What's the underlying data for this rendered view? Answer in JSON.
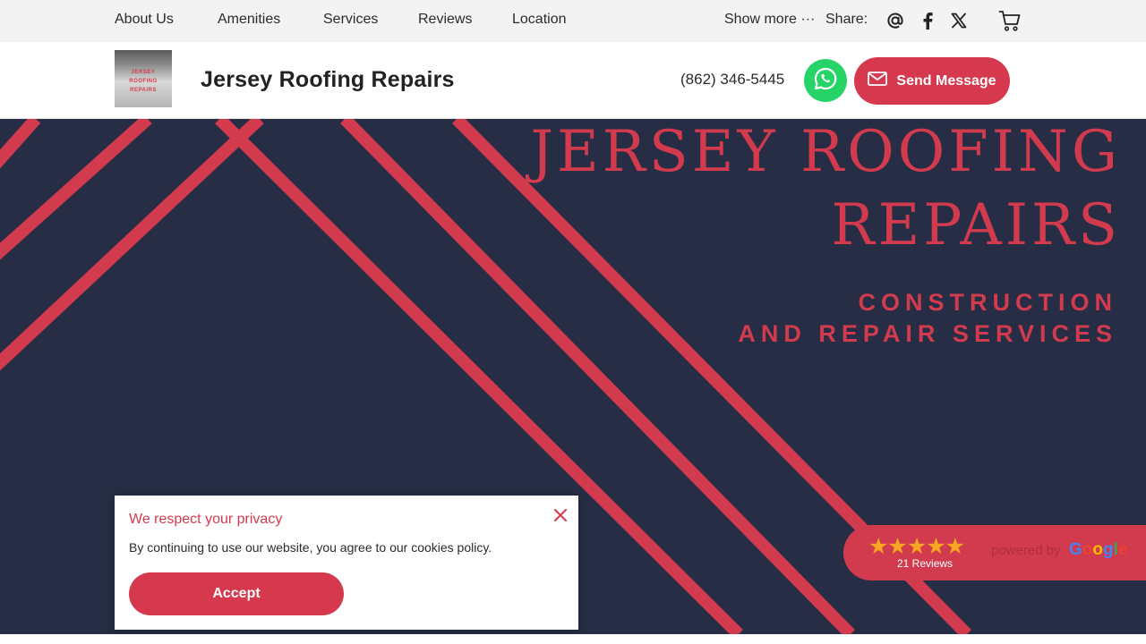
{
  "nav": {
    "items": [
      {
        "label": "About Us"
      },
      {
        "label": "Amenities"
      },
      {
        "label": "Services"
      },
      {
        "label": "Reviews"
      },
      {
        "label": "Location"
      }
    ],
    "show_more": "Show more ···",
    "share_label": "Share:",
    "share_icons": [
      "at-icon",
      "facebook-icon",
      "x-icon"
    ],
    "cart_icon": "cart-icon"
  },
  "header": {
    "logo_text": "JERSEY ROOFING REPAIRS",
    "brand_name": "Jersey Roofing Repairs",
    "phone": "(862) 346-5445",
    "whatsapp_icon": "whatsapp-icon",
    "send_button_label": "Send Message",
    "send_icon": "mail-icon"
  },
  "hero": {
    "title_line1": "JERSEY ROOFING",
    "title_line2": "REPAIRS",
    "subtitle_line1": "CONSTRUCTION",
    "subtitle_line2": "AND REPAIR SERVICES"
  },
  "reviews_badge": {
    "rating": 5,
    "stars": "★★★★★",
    "count_label": "21 Reviews",
    "powered_by": "powered by",
    "provider": "Google"
  },
  "privacy": {
    "title": "We respect your privacy",
    "text": "By continuing to use our website, you agree to our cookies policy.",
    "accept_label": "Accept"
  },
  "colors": {
    "accent": "#d6394e",
    "hero_bg": "#262d44",
    "nav_bg": "#f3f3f4",
    "whatsapp": "#25d366",
    "star": "#f6a623"
  }
}
